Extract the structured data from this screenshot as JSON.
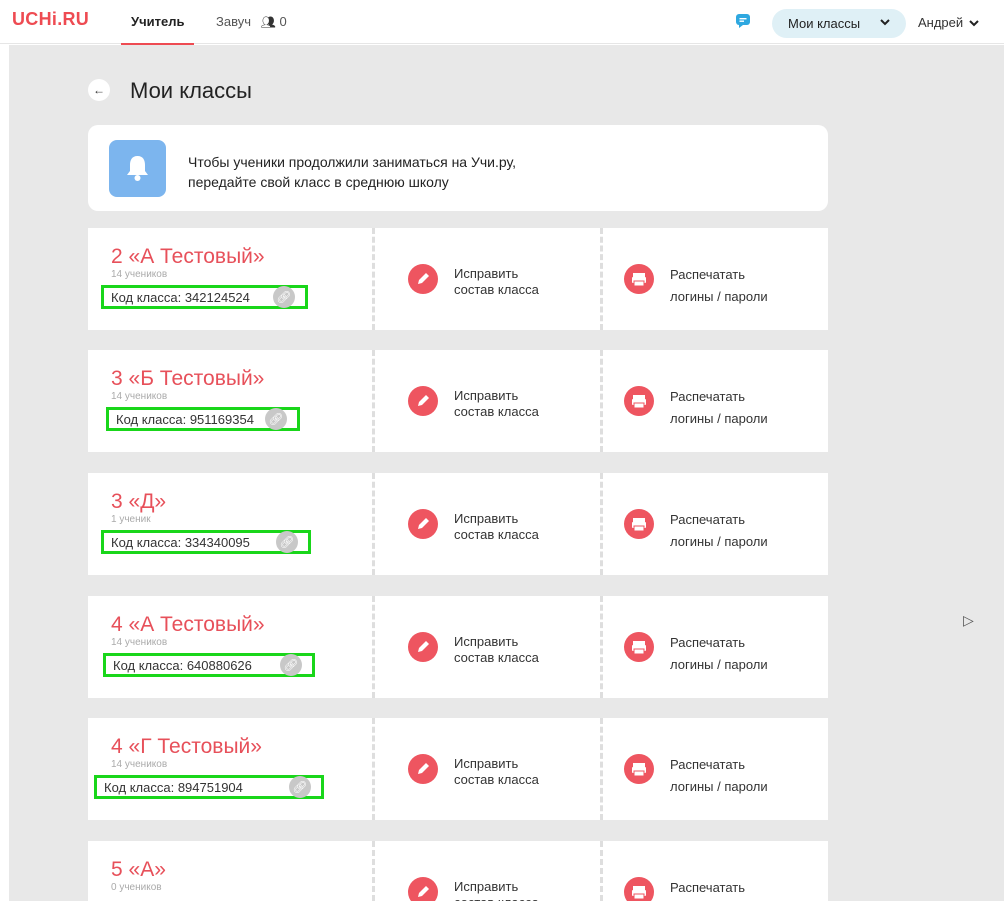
{
  "header": {
    "logo": "UCHi.RU",
    "tab_teacher": "Учитель",
    "tab_zavuch": "Завуч",
    "zavuch_count": "0",
    "classes_label": "Мои классы",
    "user": "Андрей"
  },
  "page": {
    "title": "Мои классы",
    "notice_line1": "Чтобы ученики продолжили заниматься на Учи.ру,",
    "notice_line2": "передайте свой класс в среднюю школу"
  },
  "colors": {
    "accent": "#ee4b52",
    "highlight": "#19d61a",
    "notice_icon": "#7cb5ee"
  },
  "actions": {
    "edit_line1": "Исправить",
    "edit_line2": "состав класса",
    "print_line1": "Распечатать",
    "print_line2": "логины / пароли"
  },
  "classes": [
    {
      "name": "2 «А Тестовый»",
      "count": "14 учеников",
      "code": "Код класса: 342124524"
    },
    {
      "name": "3 «Б Тестовый»",
      "count": "14 учеников",
      "code": "Код класса: 951169354"
    },
    {
      "name": "3 «Д»",
      "count": "1 ученик",
      "code": "Код класса: 334340095"
    },
    {
      "name": "4 «А Тестовый»",
      "count": "14 учеников",
      "code": "Код класса: 640880626"
    },
    {
      "name": "4 «Г Тестовый»",
      "count": "14 учеников",
      "code": "Код класса: 894751904"
    },
    {
      "name": "5 «А»",
      "count": "0 учеников",
      "code": ""
    }
  ]
}
